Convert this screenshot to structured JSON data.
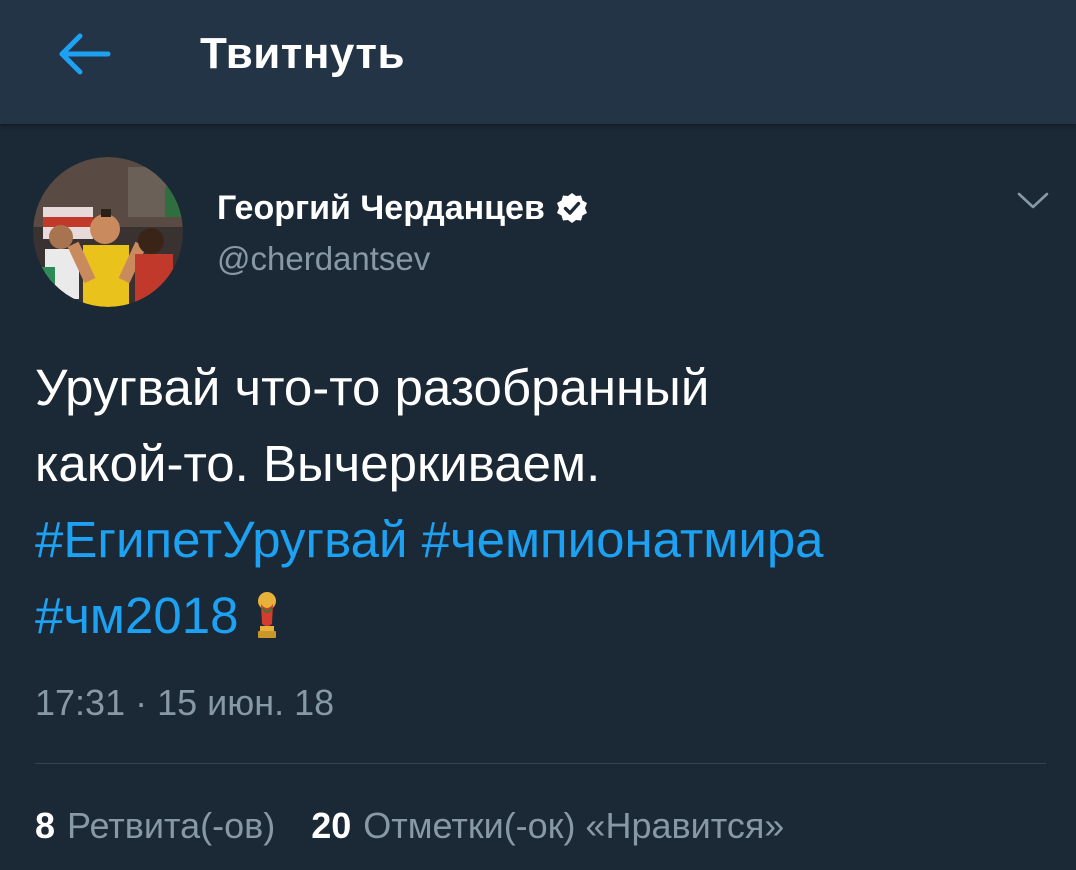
{
  "topbar": {
    "title": "Твитнуть",
    "back_icon": "arrow-left-icon"
  },
  "colors": {
    "background": "#1b2836",
    "topbar": "#243447",
    "accent": "#1da1f2",
    "secondary_text": "#8899a6",
    "primary_text": "#ffffff"
  },
  "author": {
    "name": "Георгий Черданцев",
    "handle": "@cherdantsev",
    "verified": true,
    "verified_icon": "verified-badge-icon"
  },
  "tweet": {
    "text_line1": "Уругвай что-то разобранный",
    "text_line2": "какой-то. Вычеркиваем.",
    "hashtags": [
      "#ЕгипетУругвай",
      "#чемпионатмира",
      "#чм2018"
    ],
    "emoji_icon": "world-cup-trophy-icon",
    "timestamp": "17:31 · 15 июн. 18"
  },
  "stats": {
    "retweets_count": "8",
    "retweets_label": "Ретвита(-ов)",
    "likes_count": "20",
    "likes_label": "Отметки(-ок) «Нравится»"
  }
}
